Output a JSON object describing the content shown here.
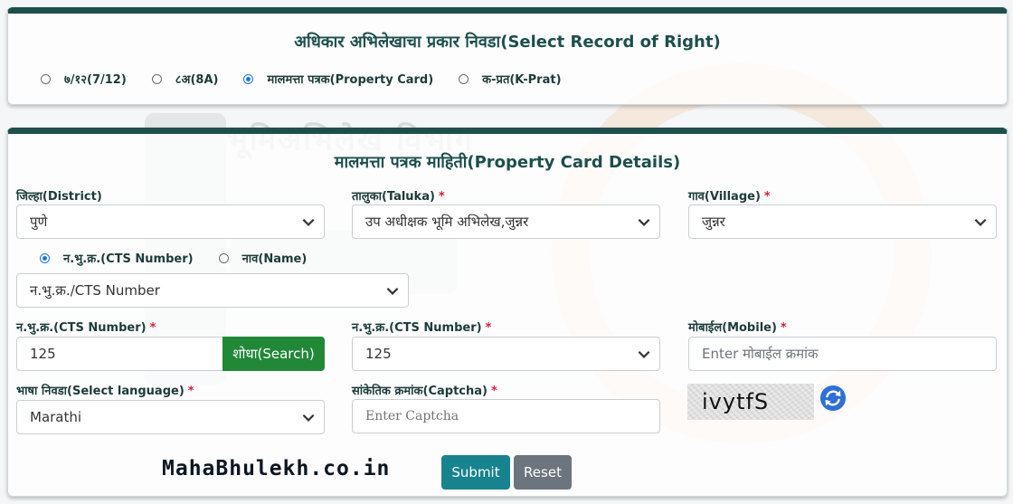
{
  "record_type_section": {
    "title": "अधिकार अभिलेखाचा प्रकार निवडा(Select Record of Right)",
    "options": [
      {
        "label": "७/१२(7/12)",
        "selected": false
      },
      {
        "label": "८अ(8A)",
        "selected": false
      },
      {
        "label": "मालमत्ता पत्रक(Property Card)",
        "selected": true
      },
      {
        "label": "क-प्रत(K-Prat)",
        "selected": false
      }
    ]
  },
  "watermark": {
    "text": "भूमिअभिलेख विभाग"
  },
  "property_card": {
    "title": "मालमत्ता पत्रक माहिती(Property Card Details)",
    "district": {
      "label": "जिल्हा(District)",
      "value": "पुणे"
    },
    "taluka": {
      "label": "तालुका(Taluka)",
      "value": "उप अधीक्षक भूमि अभिलेख,जुन्नर",
      "required_mark": "*"
    },
    "village": {
      "label": "गाव(Village)",
      "value": "जुन्नर",
      "required_mark": "*"
    },
    "search_by": [
      {
        "label": "न.भु.क्र.(CTS Number)",
        "selected": true
      },
      {
        "label": "नाव(Name)",
        "selected": false
      }
    ],
    "search_type": {
      "value": "न.भु.क्र./CTS Number"
    },
    "cts_input": {
      "label": "न.भु.क्र.(CTS Number)",
      "value": "125",
      "required_mark": "*"
    },
    "search_button": "शोधा(Search)",
    "cts_select": {
      "label": "न.भु.क्र.(CTS Number)",
      "value": "125",
      "required_mark": "*"
    },
    "mobile": {
      "label": "मोबाईल(Mobile)",
      "placeholder": "Enter मोबाईल क्रमांक",
      "required_mark": "*"
    },
    "language": {
      "label": "भाषा निवडा(Select language)",
      "value": "Marathi",
      "required_mark": "*"
    },
    "captcha_field": {
      "label": "सांकेतिक क्रमांक(Captcha)",
      "placeholder": "Enter Captcha",
      "required_mark": "*"
    },
    "captcha_text": "ivytfS",
    "submit_button": "Submit",
    "reset_button": "Reset"
  },
  "brand": "MahaBhulekh.co.in",
  "colors": {
    "header_border": "#1d4f4c",
    "search_button": "#218838",
    "submit_button": "#17838f",
    "reset_button": "#6c757d",
    "required": "#d3232f",
    "radio_accent": "#1a73e8"
  },
  "icons": {
    "select_arrow": "chevron-down-icon",
    "captcha_refresh": "refresh-icon"
  }
}
